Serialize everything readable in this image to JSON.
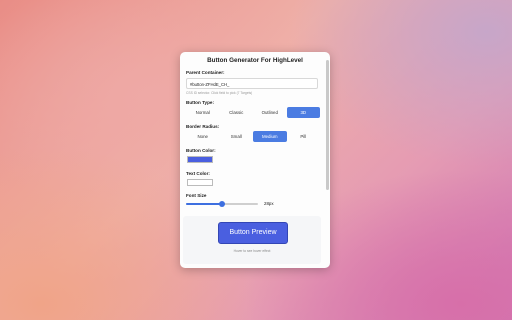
{
  "title": "Button Generator For HighLevel",
  "parent_container": {
    "label": "Parent Container:",
    "value": "#button-ZFHdE_CH_",
    "hint": "CSS ID selector. Click field to pick (7 Targets)"
  },
  "button_type": {
    "label": "Button Type:",
    "options": [
      "Normal",
      "Classic",
      "Outlined",
      "3D"
    ],
    "active": "3D"
  },
  "border_radius": {
    "label": "Border Radius:",
    "options": [
      "None",
      "Small",
      "Medium",
      "Pill"
    ],
    "active": "Medium"
  },
  "button_color": {
    "label": "Button Color:",
    "value": "#4a5fe0"
  },
  "text_color": {
    "label": "Text Color:",
    "value": "#ffffff"
  },
  "font_size": {
    "label": "Font Size",
    "value": "28px",
    "level": 0.5
  },
  "preview": {
    "button_label": "Button Preview",
    "hint": "Hover to see hover effect"
  },
  "colors": {
    "accent": "#4b7ce2"
  }
}
